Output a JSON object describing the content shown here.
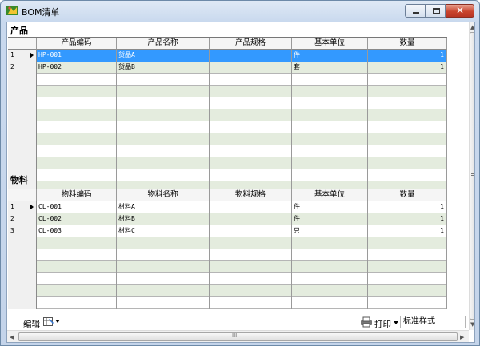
{
  "window": {
    "title": "BOM清单",
    "icon": "app-icon",
    "buttons": [
      "minimize-icon",
      "maximize-icon",
      "close-icon"
    ],
    "close_glyph": "✕"
  },
  "products": {
    "label": "产品",
    "columns": [
      "产品编码",
      "产品名称",
      "产品规格",
      "基本单位",
      "数量"
    ],
    "rows": [
      {
        "num": "1",
        "code": "HP-001",
        "name": "货品A",
        "spec": "",
        "unit": "件",
        "qty": "1",
        "selected": true
      },
      {
        "num": "2",
        "code": "HP-002",
        "name": "货品B",
        "spec": "",
        "unit": "套",
        "qty": "1"
      }
    ],
    "total_rows": 12
  },
  "materials": {
    "label": "物料",
    "columns": [
      "物料编码",
      "物料名称",
      "物料规格",
      "基本单位",
      "数量"
    ],
    "rows": [
      {
        "num": "1",
        "code": "CL-001",
        "name": "材料A",
        "spec": "",
        "unit": "件",
        "qty": "1",
        "current": true
      },
      {
        "num": "2",
        "code": "CL-002",
        "name": "材料B",
        "spec": "",
        "unit": "件",
        "qty": "1"
      },
      {
        "num": "3",
        "code": "CL-003",
        "name": "材料C",
        "spec": "",
        "unit": "只",
        "qty": "1"
      }
    ],
    "total_rows": 9
  },
  "toolbar": {
    "edit_label": "编辑",
    "print_label": "打印",
    "style_value": "标准样式",
    "hscroll_mid": "III"
  },
  "colors": {
    "selected": "#3399ff",
    "alt_row": "#e4ecde"
  }
}
